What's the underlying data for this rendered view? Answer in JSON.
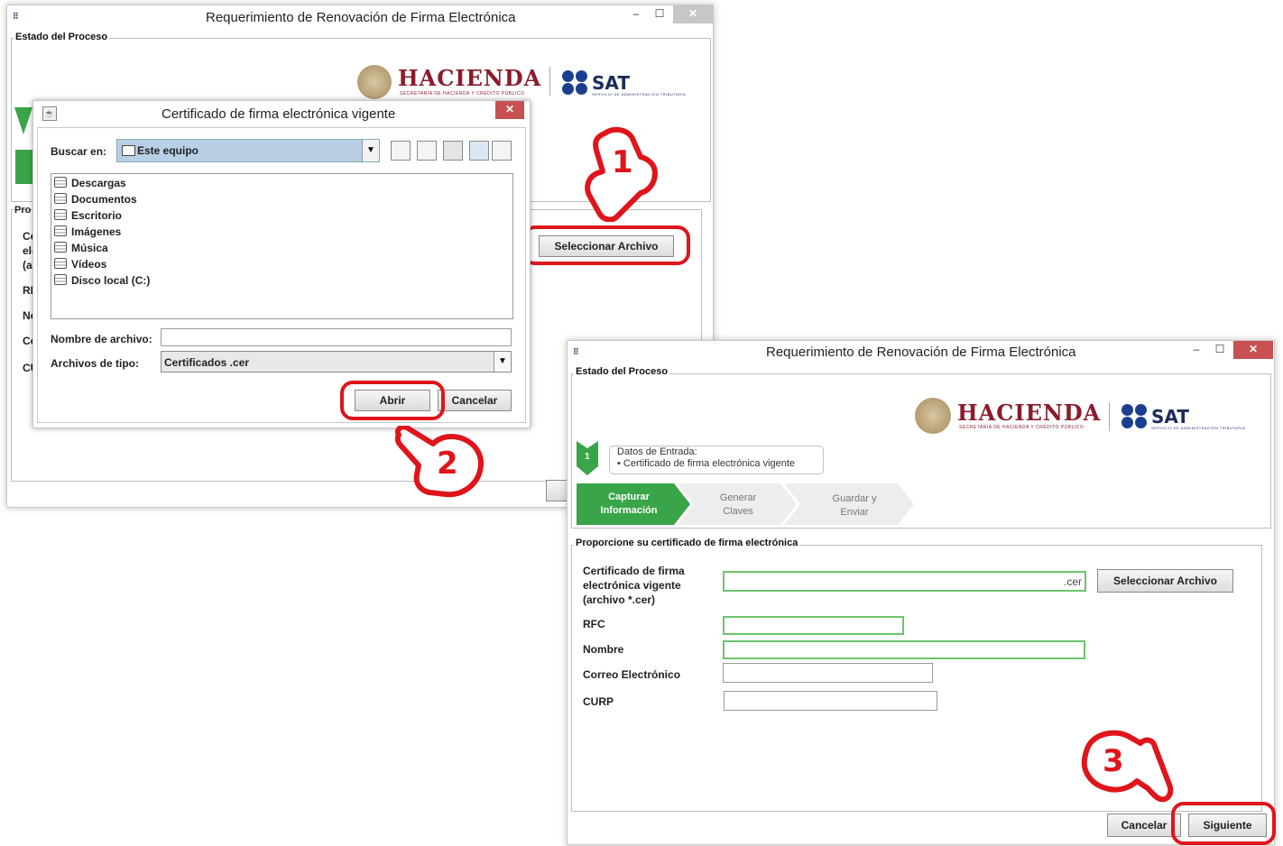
{
  "window_back": {
    "title": "Requerimiento de Renovación de Firma Electrónica",
    "section_label": "Estado del Proceso",
    "partial_labels": [
      "Pro",
      "Ce",
      "ele",
      "(ar",
      "RF",
      "No",
      "Co",
      "CU"
    ],
    "select_button": "Seleccionar Archivo"
  },
  "dialog": {
    "title": "Certificado de firma electrónica vigente",
    "look_in_label": "Buscar en:",
    "look_in_value": "Este equipo",
    "items": [
      "Descargas",
      "Documentos",
      "Escritorio",
      "Imágenes",
      "Música",
      "Vídeos",
      "Disco local (C:)"
    ],
    "filename_label": "Nombre de archivo:",
    "filename_value": "",
    "filetype_label": "Archivos de tipo:",
    "filetype_value": "Certificados .cer",
    "open_button": "Abrir",
    "cancel_button": "Cancelar"
  },
  "window_front": {
    "title": "Requerimiento de Renovación de Firma Electrónica",
    "section_label": "Estado del Proceso",
    "input_box_title": "Datos de Entrada:",
    "input_box_item": "•   Certificado de firma electrónica vigente",
    "step_number": "1",
    "steps": [
      {
        "label": "Capturar Información",
        "active": true
      },
      {
        "label": "Generar Claves",
        "active": false
      },
      {
        "label": "Guardar y Enviar",
        "active": false
      }
    ],
    "form_section": "Proporcione su certificado de firma electrónica",
    "cert_label": "Certificado de firma electrónica vigente (archivo *.cer)",
    "cert_suffix": ".cer",
    "select_button": "Seleccionar Archivo",
    "rfc_label": "RFC",
    "name_label": "Nombre",
    "email_label": "Correo Electrónico",
    "curp_label": "CURP",
    "cancel_button": "Cancelar",
    "next_button": "Siguiente"
  },
  "logos": {
    "hacienda": "HACIENDA",
    "hacienda_sub": "SECRETARÍA DE HACIENDA Y CRÉDITO PÚBLICO",
    "sat": "SAT",
    "sat_sub": "SERVICIO DE ADMINISTRACIÓN TRIBUTARIA"
  },
  "callouts": [
    "1",
    "2",
    "3"
  ],
  "colors": {
    "highlight": "#e0141b",
    "step_active": "#3aa548",
    "field_ok": "#6cc46c",
    "dialog_combo": "#b8cfe6"
  }
}
